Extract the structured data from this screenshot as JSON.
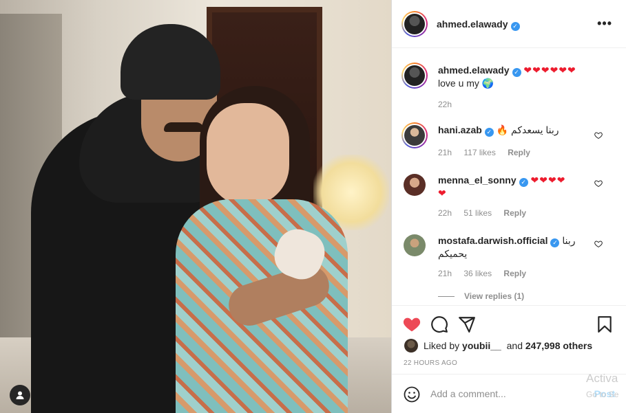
{
  "post": {
    "author": "ahmed.elawady",
    "more_label": "•••"
  },
  "caption": {
    "username": "ahmed.elawady",
    "hearts": "❤❤❤❤❤❤",
    "text": "love u my 🌍",
    "time": "22h"
  },
  "comments": [
    {
      "username": "hani.azab",
      "text": "ربنا يسعدكم 🔥",
      "time": "21h",
      "likes": "117 likes",
      "reply": "Reply"
    },
    {
      "username": "menna_el_sonny",
      "text": "❤❤❤❤",
      "text2": "❤",
      "time": "22h",
      "likes": "51 likes",
      "reply": "Reply"
    },
    {
      "username": "mostafa.darwish.official",
      "text": "ربنا",
      "text2": "يحميكم",
      "time": "21h",
      "likes": "36 likes",
      "reply": "Reply"
    }
  ],
  "view_replies": "View replies (1)",
  "likes": {
    "prefix": "Liked by",
    "user": "youbii__",
    "and": "and",
    "count": "247,998 others"
  },
  "time_ago": "22 HOURS AGO",
  "add_comment": {
    "placeholder": "Add a comment...",
    "post": "Post"
  },
  "watermark": {
    "line1": "Activa",
    "line2": "Go to Se"
  },
  "colors": {
    "verified": "#3897f0",
    "like_red": "#ed4956",
    "muted": "#8e8e8e"
  }
}
